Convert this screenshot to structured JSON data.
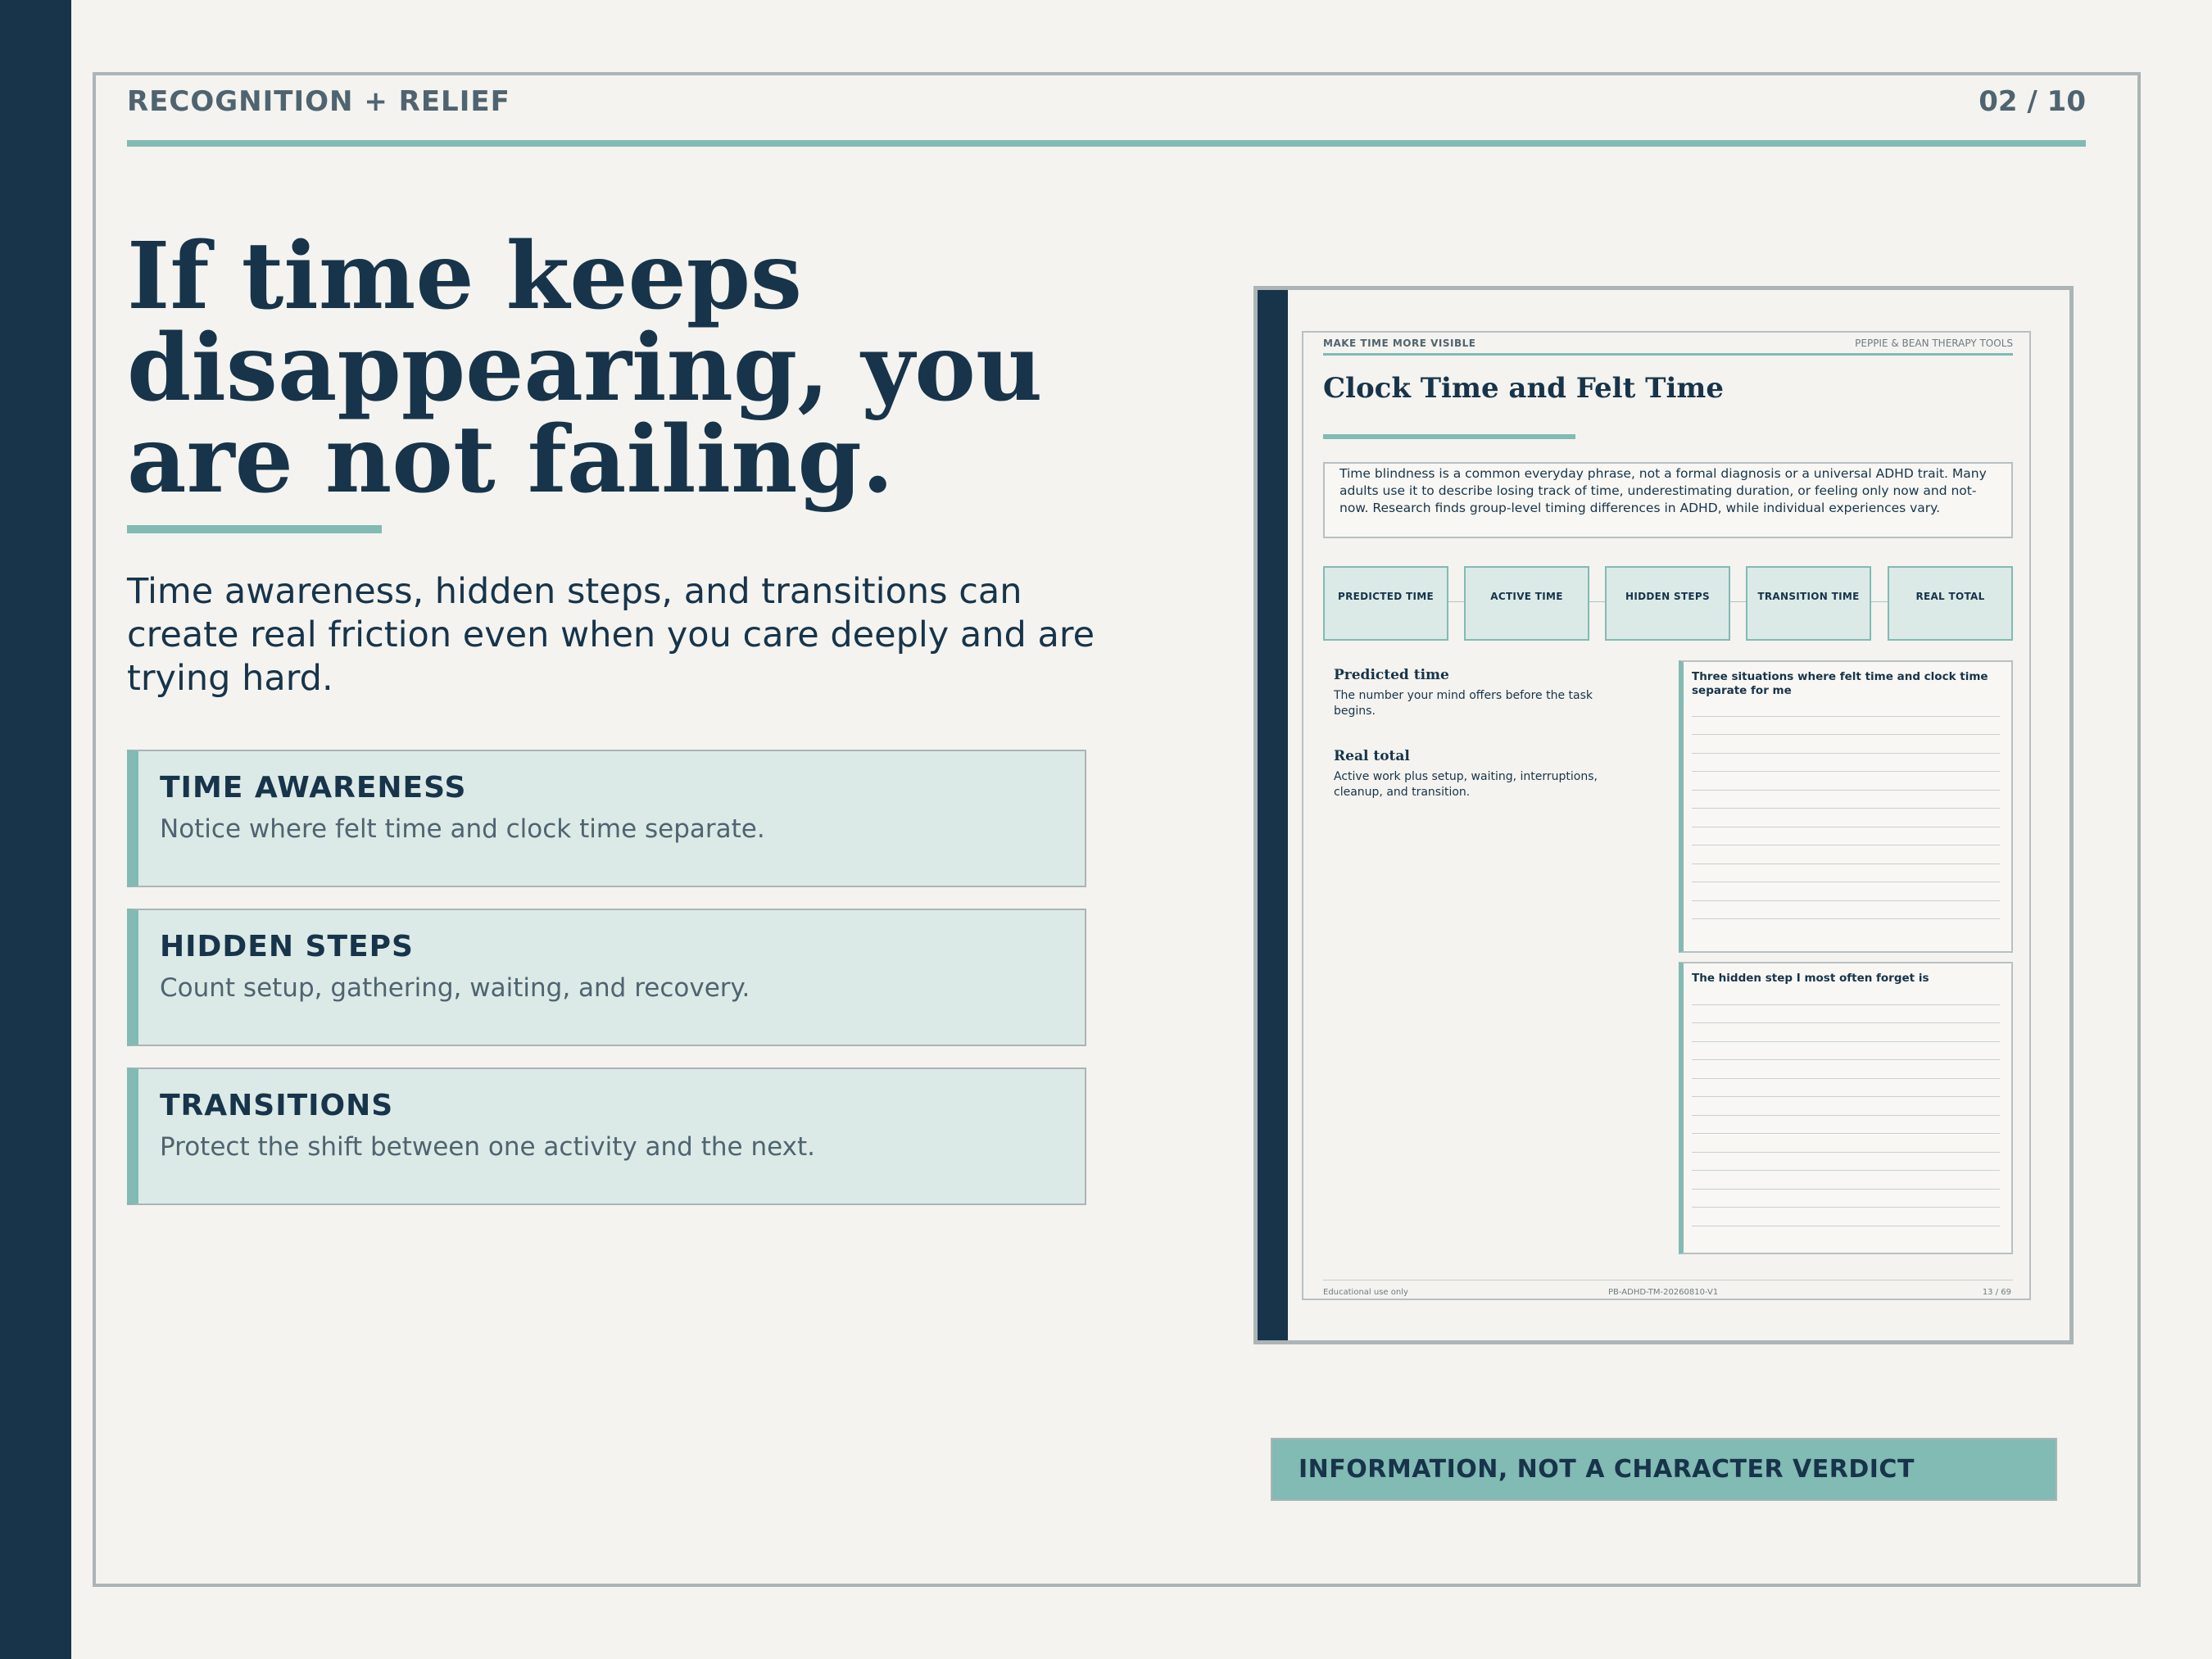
{
  "header": {
    "section_label": "RECOGNITION + RELIEF",
    "page_count": "02 / 10"
  },
  "main": {
    "headline": "If time keeps disappearing, you are not failing.",
    "subhead": "Time awareness, hidden steps, and transitions can create real friction even when you care deeply and are trying hard.",
    "cards": [
      {
        "title": "TIME AWARENESS",
        "text": "Notice where felt time and clock time separate."
      },
      {
        "title": "HIDDEN STEPS",
        "text": "Count setup, gathering, waiting, and recovery."
      },
      {
        "title": "TRANSITIONS",
        "text": "Protect the shift between one activity and the next."
      }
    ]
  },
  "preview": {
    "kicker": "MAKE TIME MORE VISIBLE",
    "brand": "PEPPIE & BEAN THERAPY TOOLS",
    "title": "Clock Time and Felt Time",
    "intro": "Time blindness is a common everyday phrase, not a formal diagnosis or a universal ADHD trait. Many adults use it to describe losing track of time, underestimating duration, or feeling only now and not-now. Research finds group-level timing differences in ADHD, while individual experiences vary.",
    "flow": [
      "PREDICTED TIME",
      "ACTIVE TIME",
      "HIDDEN STEPS",
      "TRANSITION TIME",
      "REAL TOTAL"
    ],
    "definitions": [
      {
        "title": "Predicted time",
        "text": "The number your mind offers before the task begins."
      },
      {
        "title": "Real total",
        "text": "Active work plus setup, waiting, interruptions, cleanup, and transition."
      }
    ],
    "prompts": [
      "Three situations where felt time and clock time separate for me",
      "The hidden step I most often forget is"
    ],
    "footer": {
      "left": "Educational use only",
      "center": "PB-ADHD-TM-20260810-V1",
      "right": "13 / 69"
    }
  },
  "callout": "INFORMATION, NOT A CHARACTER VERDICT",
  "colors": {
    "navy": "#17344a",
    "teal": "#82bab4",
    "pale_teal": "#dceae7",
    "background": "#f4f3ef",
    "slate": "#4f6470"
  }
}
